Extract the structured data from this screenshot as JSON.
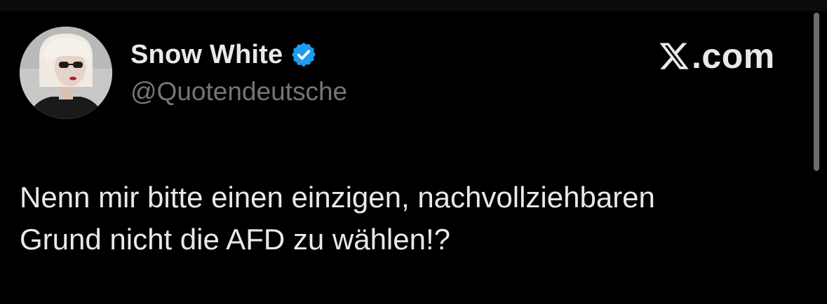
{
  "post": {
    "author": {
      "display_name": "Snow White",
      "handle": "@Quotendeutsche",
      "verified_icon": "verified-badge-icon",
      "avatar_icon": "profile-photo"
    },
    "brand": {
      "icon": "x-logo-icon",
      "text": ".com"
    },
    "text_lines": [
      "Nenn mir bitte einen einzigen, nachvollziehbaren",
      "Grund nicht die AFD zu wählen!?"
    ]
  },
  "colors": {
    "background": "#000000",
    "primary_text": "#e7e9ea",
    "secondary_text": "#71767b",
    "verified_blue": "#1d9bf0"
  }
}
